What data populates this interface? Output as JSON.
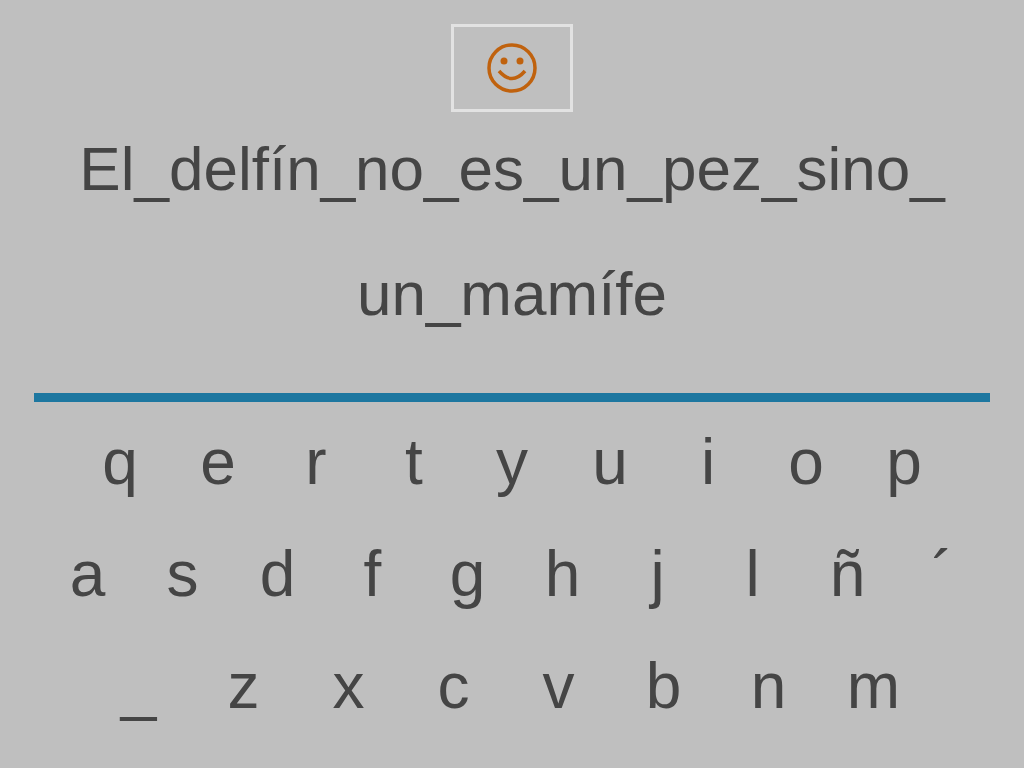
{
  "puzzle": {
    "lines": [
      "El_delfín_no_es_un_pez_sino_",
      "un_mamífe"
    ]
  },
  "keyboard": {
    "rows": [
      [
        "q",
        "e",
        "r",
        "t",
        "y",
        "u",
        "i",
        "o",
        "p"
      ],
      [
        "a",
        "s",
        "d",
        "f",
        "g",
        "h",
        "j",
        "l",
        "ñ",
        "´"
      ],
      [
        "_",
        "z",
        "x",
        "c",
        "v",
        "b",
        "n",
        "m"
      ]
    ]
  }
}
